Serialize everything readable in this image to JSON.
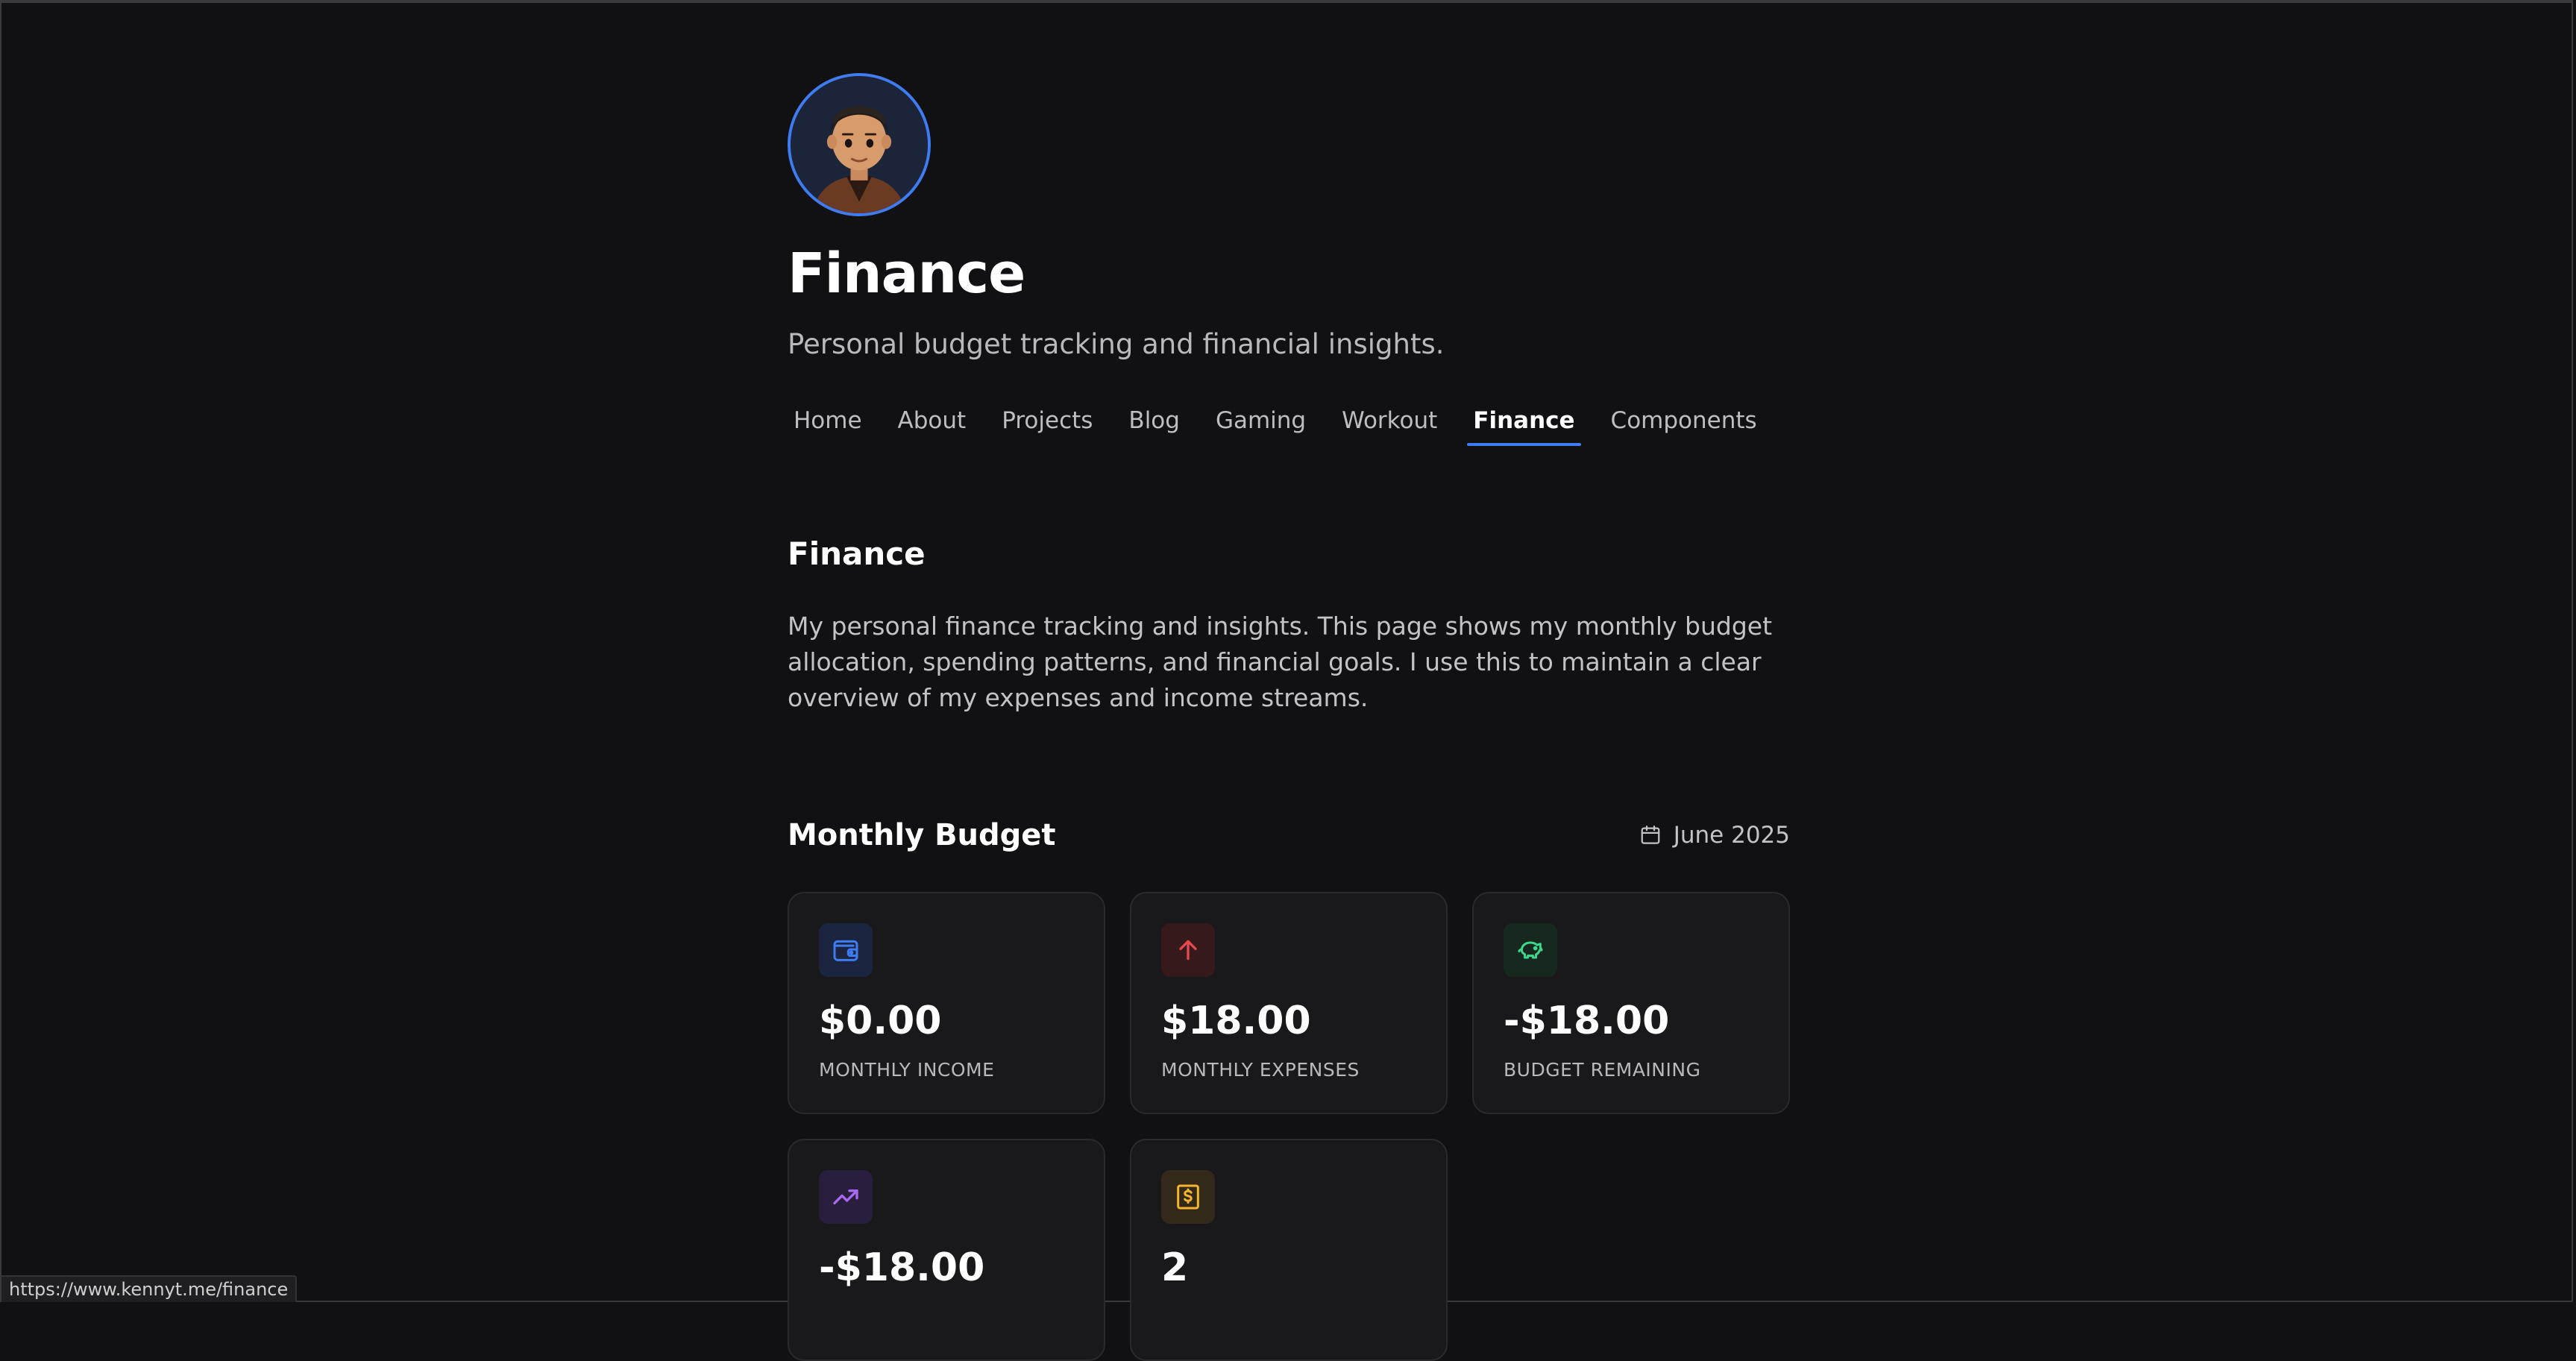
{
  "header": {
    "title": "Finance",
    "subtitle": "Personal budget tracking and financial insights."
  },
  "nav": {
    "items": [
      {
        "label": "Home"
      },
      {
        "label": "About"
      },
      {
        "label": "Projects"
      },
      {
        "label": "Blog"
      },
      {
        "label": "Gaming"
      },
      {
        "label": "Workout"
      },
      {
        "label": "Finance"
      },
      {
        "label": "Components"
      }
    ],
    "active": "Finance"
  },
  "section": {
    "title": "Finance",
    "intro": "My personal finance tracking and insights. This page shows my monthly budget allocation, spending patterns, and financial goals. I use this to maintain a clear overview of my expenses and income streams."
  },
  "budget": {
    "title": "Monthly Budget",
    "month": "June 2025",
    "cards": [
      {
        "value": "$0.00",
        "label": "MONTHLY INCOME",
        "icon": "wallet-icon",
        "color": "#3f7cf1",
        "bg": "#1c2540"
      },
      {
        "value": "$18.00",
        "label": "MONTHLY EXPENSES",
        "icon": "arrow-up-icon",
        "color": "#e5484d",
        "bg": "#35191b"
      },
      {
        "value": "-$18.00",
        "label": "BUDGET REMAINING",
        "icon": "piggy-bank-icon",
        "color": "#3dd68c",
        "bg": "#17291f"
      },
      {
        "value": "-$18.00",
        "label": "",
        "icon": "trending-up-icon",
        "color": "#a66bf0",
        "bg": "#2a1e3e"
      },
      {
        "value": "2",
        "label": "",
        "icon": "receipt-icon",
        "color": "#f5b52e",
        "bg": "#32291a"
      }
    ]
  },
  "status_bar": {
    "url": "https://www.kennyt.me/finance"
  }
}
